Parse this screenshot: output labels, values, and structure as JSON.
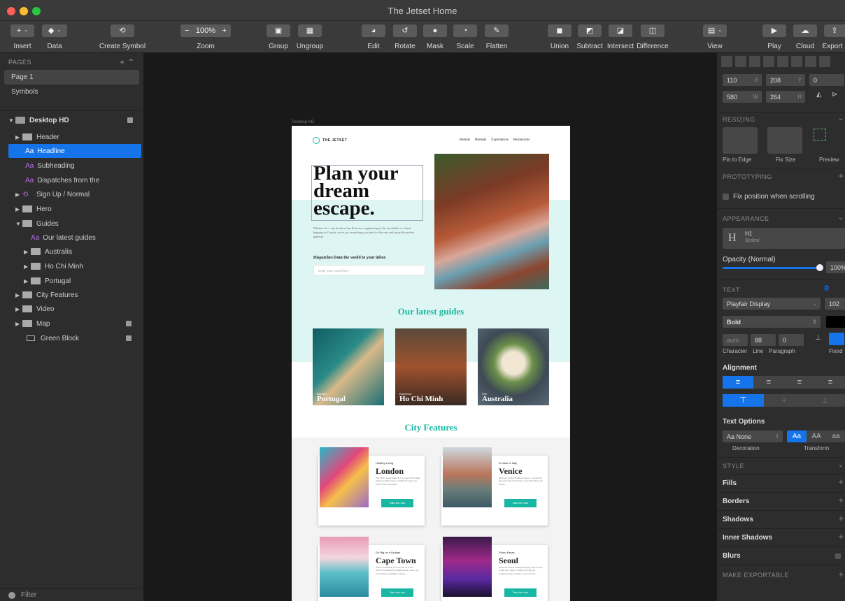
{
  "window": {
    "title": "The Jetset Home"
  },
  "toolbar": {
    "insert": "Insert",
    "data": "Data",
    "create_symbol": "Create Symbol",
    "zoom_label": "Zoom",
    "zoom_value": "100%",
    "group": "Group",
    "ungroup": "Ungroup",
    "edit": "Edit",
    "rotate": "Rotate",
    "mask": "Mask",
    "scale": "Scale",
    "flatten": "Flatten",
    "union": "Union",
    "subtract": "Subtract",
    "intersect": "Intersect",
    "difference": "Difference",
    "view": "View",
    "play": "Play",
    "cloud": "Cloud",
    "export": "Export"
  },
  "pages": {
    "header": "PAGES",
    "items": [
      "Page 1",
      "Symbols"
    ]
  },
  "layers": {
    "artboard": "Desktop HD",
    "items": [
      {
        "label": "Header",
        "type": "folder"
      },
      {
        "label": "Headline",
        "type": "text",
        "selected": true
      },
      {
        "label": "Subheading",
        "type": "text"
      },
      {
        "label": "Dispatches from the",
        "type": "text"
      },
      {
        "label": "Sign Up / Normal",
        "type": "symbol"
      },
      {
        "label": "Hero",
        "type": "folder"
      },
      {
        "label": "Guides",
        "type": "folder"
      },
      {
        "label": "Our latest guides",
        "type": "text"
      },
      {
        "label": "Australia",
        "type": "folder"
      },
      {
        "label": "Ho Chi Minh",
        "type": "folder"
      },
      {
        "label": "Portugal",
        "type": "folder"
      },
      {
        "label": "City Features",
        "type": "folder"
      },
      {
        "label": "Video",
        "type": "folder"
      },
      {
        "label": "Map",
        "type": "folder"
      },
      {
        "label": "Green Block",
        "type": "rect"
      }
    ],
    "filter": "Filter"
  },
  "artboard": {
    "label": "Desktop HD",
    "logo": "THE JETSET",
    "nav": [
      "Rentals",
      "Retreats",
      "Experiences",
      "Restaurants"
    ],
    "headline_l1": "Plan your",
    "headline_l2": "dream",
    "headline_l3": "escape.",
    "body": "Whether it's a city break in San Francisco, sightseeing in the Seychelles or island hopping in Croatia, we've got everything you need to discover and enjoy the perfect getaway.",
    "dispatch": "Dispatches from the world to your inbox",
    "email_placeholder": "Enter your email here",
    "guides_title": "Our latest guides",
    "guides": [
      {
        "tag": "Discover",
        "name": "Portugal"
      },
      {
        "tag": "Experience",
        "name": "Ho Chi Minh"
      },
      {
        "tag": "Feel",
        "name": "Australia"
      }
    ],
    "features_title": "City Features",
    "features": [
      {
        "tag": "Healthy Living",
        "city": "London",
        "blurb": "The UK's capital might not be your first thought when you think about a healthy lifestyle, but you're in for a surprise...",
        "cta": "Take the tour"
      },
      {
        "tag": "A Taste of Italy",
        "city": "Venice",
        "blurb": "Discover Venice's hidden eateries – restaurants and cafes that locals know and tourists have not found...",
        "cta": "Take the tour"
      },
      {
        "tag": "Go Big on a Budget",
        "city": "Cape Town",
        "blurb": "There's something for everyone in South Africa's beautiful and multicultural centre. See it all without spending a fortune...",
        "cta": "Take the tour"
      },
      {
        "tag": "Photo Essay",
        "city": "Seoul",
        "blurb": "From the ancient Changdeokgung Palace to the bright neon lights of Myeong-dong and Gangnam, there's plenty to see in Seoul...",
        "cta": "Take the tour"
      }
    ]
  },
  "inspector": {
    "x": "110",
    "y": "208",
    "rot": "0",
    "w": "580",
    "h": "264",
    "unit_x": "X",
    "unit_y": "Y",
    "unit_w": "W",
    "unit_h": "H",
    "resizing": "RESIZING",
    "pin": "Pin to Edge",
    "fix": "Fix Size",
    "preview": "Preview",
    "prototyping": "PROTOTYPING",
    "fixpos": "Fix position when scrolling",
    "appearance": "APPEARANCE",
    "style_name": "H1",
    "style_path": "Styles/",
    "opacity": "Opacity (Normal)",
    "opacity_value": "100%",
    "text": "TEXT",
    "font": "Playfair Display",
    "font_size": "102",
    "weight": "Bold",
    "char": "auto",
    "line": "88",
    "para": "0",
    "char_label": "Character",
    "line_label": "Line",
    "para_label": "Paragraph",
    "fixed_label": "Fixed",
    "alignment": "Alignment",
    "text_options": "Text Options",
    "decoration": "Aa None",
    "decoration_label": "Decoration",
    "transform_label": "Transform",
    "tr1": "Aa",
    "tr2": "AA",
    "tr3": "aa",
    "style": "STYLE",
    "fills": "Fills",
    "borders": "Borders",
    "shadows": "Shadows",
    "inner_shadows": "Inner Shadows",
    "blurs": "Blurs",
    "exportable": "MAKE EXPORTABLE"
  },
  "colors": {
    "accent": "#1674ea",
    "teal": "#19b7a3",
    "mint": "#def6f3"
  }
}
